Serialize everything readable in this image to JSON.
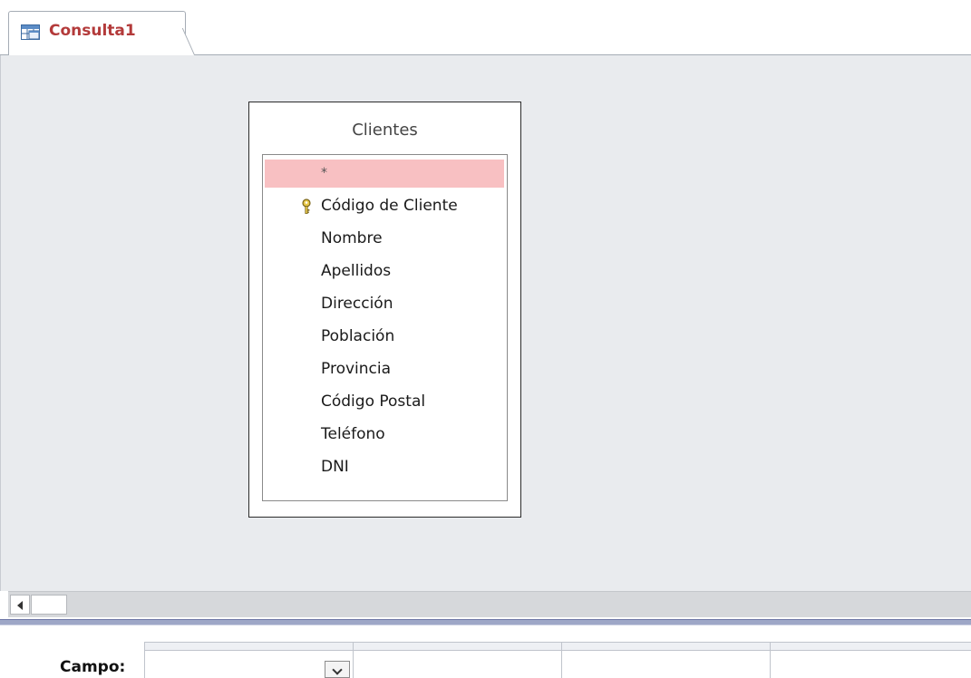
{
  "tab": {
    "label": "Consulta1",
    "icon": "query-icon"
  },
  "table": {
    "title": "Clientes",
    "fields": [
      {
        "label": "*",
        "selected": true,
        "key": false
      },
      {
        "label": "Código de Cliente",
        "selected": false,
        "key": true
      },
      {
        "label": "Nombre",
        "selected": false,
        "key": false
      },
      {
        "label": "Apellidos",
        "selected": false,
        "key": false
      },
      {
        "label": "Dirección",
        "selected": false,
        "key": false
      },
      {
        "label": "Población",
        "selected": false,
        "key": false
      },
      {
        "label": "Provincia",
        "selected": false,
        "key": false
      },
      {
        "label": "Código Postal",
        "selected": false,
        "key": false
      },
      {
        "label": "Teléfono",
        "selected": false,
        "key": false
      },
      {
        "label": "DNI",
        "selected": false,
        "key": false
      }
    ]
  },
  "grid": {
    "row_labels": [
      "Campo:"
    ]
  },
  "colors": {
    "tab_text": "#b33a3a",
    "selected_row": "#f8c0c2",
    "canvas_bg": "#e9ebee"
  }
}
